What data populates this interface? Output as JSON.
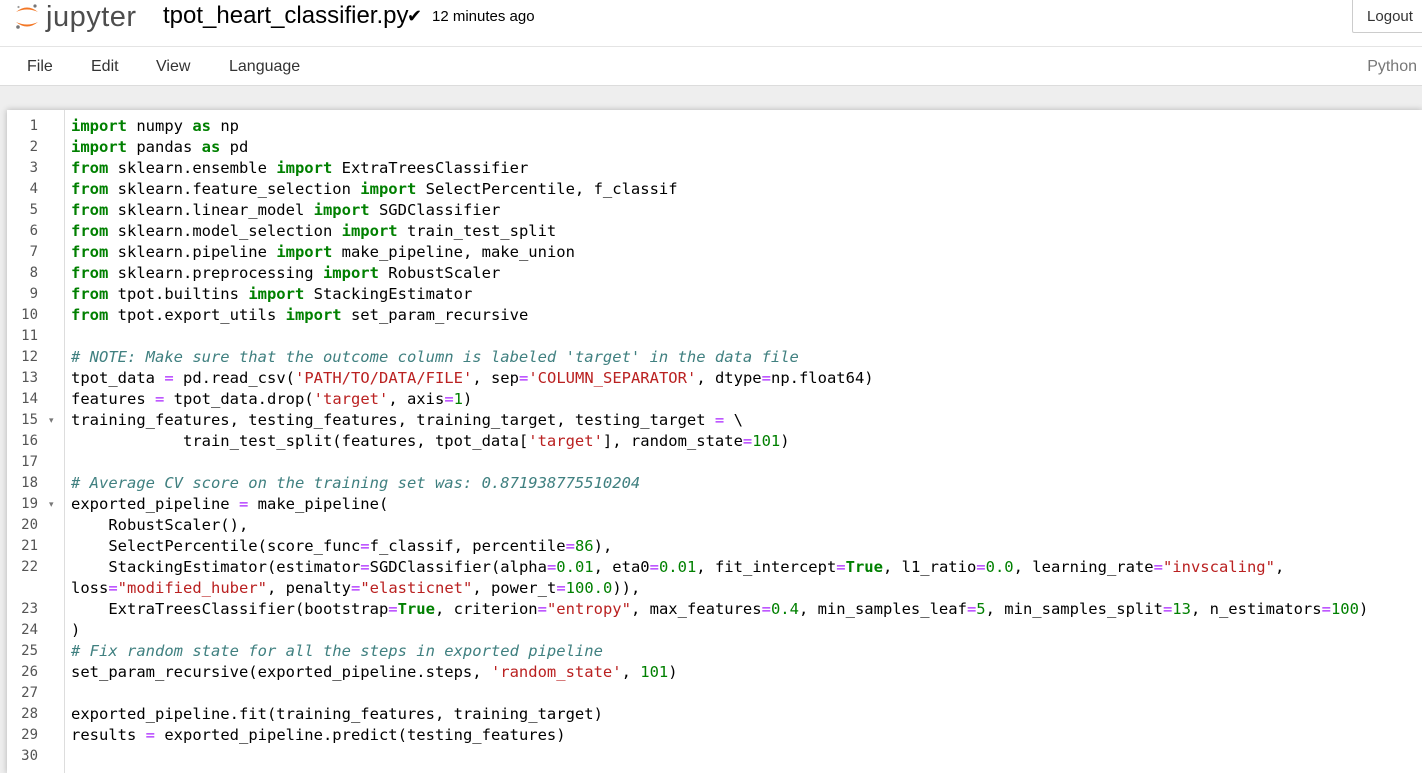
{
  "header": {
    "logo_text": "jupyter",
    "file_name": "tpot_heart_classifier.py",
    "save_status": "12 minutes ago",
    "logout_label": "Logout"
  },
  "menu": {
    "items": [
      "File",
      "Edit",
      "View",
      "Language"
    ],
    "language_indicator": "Python"
  },
  "editor": {
    "fold_markers": [
      15,
      19
    ],
    "lines": [
      [
        [
          "kw",
          "import"
        ],
        [
          "t",
          " numpy "
        ],
        [
          "kw",
          "as"
        ],
        [
          "t",
          " np"
        ]
      ],
      [
        [
          "kw",
          "import"
        ],
        [
          "t",
          " pandas "
        ],
        [
          "kw",
          "as"
        ],
        [
          "t",
          " pd"
        ]
      ],
      [
        [
          "kw",
          "from"
        ],
        [
          "t",
          " sklearn.ensemble "
        ],
        [
          "kw",
          "import"
        ],
        [
          "t",
          " ExtraTreesClassifier"
        ]
      ],
      [
        [
          "kw",
          "from"
        ],
        [
          "t",
          " sklearn.feature_selection "
        ],
        [
          "kw",
          "import"
        ],
        [
          "t",
          " SelectPercentile, f_classif"
        ]
      ],
      [
        [
          "kw",
          "from"
        ],
        [
          "t",
          " sklearn.linear_model "
        ],
        [
          "kw",
          "import"
        ],
        [
          "t",
          " SGDClassifier"
        ]
      ],
      [
        [
          "kw",
          "from"
        ],
        [
          "t",
          " sklearn.model_selection "
        ],
        [
          "kw",
          "import"
        ],
        [
          "t",
          " train_test_split"
        ]
      ],
      [
        [
          "kw",
          "from"
        ],
        [
          "t",
          " sklearn.pipeline "
        ],
        [
          "kw",
          "import"
        ],
        [
          "t",
          " make_pipeline, make_union"
        ]
      ],
      [
        [
          "kw",
          "from"
        ],
        [
          "t",
          " sklearn.preprocessing "
        ],
        [
          "kw",
          "import"
        ],
        [
          "t",
          " RobustScaler"
        ]
      ],
      [
        [
          "kw",
          "from"
        ],
        [
          "t",
          " tpot.builtins "
        ],
        [
          "kw",
          "import"
        ],
        [
          "t",
          " StackingEstimator"
        ]
      ],
      [
        [
          "kw",
          "from"
        ],
        [
          "t",
          " tpot.export_utils "
        ],
        [
          "kw",
          "import"
        ],
        [
          "t",
          " set_param_recursive"
        ]
      ],
      [],
      [
        [
          "cm",
          "# NOTE: Make sure that the outcome column is labeled 'target' in the data file"
        ]
      ],
      [
        [
          "t",
          "tpot_data "
        ],
        [
          "op",
          "="
        ],
        [
          "t",
          " pd.read_csv("
        ],
        [
          "st",
          "'PATH/TO/DATA/FILE'"
        ],
        [
          "t",
          ", sep"
        ],
        [
          "op",
          "="
        ],
        [
          "st",
          "'COLUMN_SEPARATOR'"
        ],
        [
          "t",
          ", dtype"
        ],
        [
          "op",
          "="
        ],
        [
          "t",
          "np.float64)"
        ]
      ],
      [
        [
          "t",
          "features "
        ],
        [
          "op",
          "="
        ],
        [
          "t",
          " tpot_data.drop("
        ],
        [
          "st",
          "'target'"
        ],
        [
          "t",
          ", axis"
        ],
        [
          "op",
          "="
        ],
        [
          "nm",
          "1"
        ],
        [
          "t",
          ")"
        ]
      ],
      [
        [
          "t",
          "training_features, testing_features, training_target, testing_target "
        ],
        [
          "op",
          "="
        ],
        [
          "t",
          " \\"
        ]
      ],
      [
        [
          "t",
          "            train_test_split(features, tpot_data["
        ],
        [
          "st",
          "'target'"
        ],
        [
          "t",
          "], random_state"
        ],
        [
          "op",
          "="
        ],
        [
          "nm",
          "101"
        ],
        [
          "t",
          ")"
        ]
      ],
      [],
      [
        [
          "cm",
          "# Average CV score on the training set was: 0.871938775510204"
        ]
      ],
      [
        [
          "t",
          "exported_pipeline "
        ],
        [
          "op",
          "="
        ],
        [
          "t",
          " make_pipeline("
        ]
      ],
      [
        [
          "t",
          "    RobustScaler(),"
        ]
      ],
      [
        [
          "t",
          "    SelectPercentile(score_func"
        ],
        [
          "op",
          "="
        ],
        [
          "t",
          "f_classif, percentile"
        ],
        [
          "op",
          "="
        ],
        [
          "nm",
          "86"
        ],
        [
          "t",
          "),"
        ]
      ],
      [
        [
          "t",
          "    StackingEstimator(estimator"
        ],
        [
          "op",
          "="
        ],
        [
          "t",
          "SGDClassifier(alpha"
        ],
        [
          "op",
          "="
        ],
        [
          "nm",
          "0.01"
        ],
        [
          "t",
          ", eta0"
        ],
        [
          "op",
          "="
        ],
        [
          "nm",
          "0.01"
        ],
        [
          "t",
          ", fit_intercept"
        ],
        [
          "op",
          "="
        ],
        [
          "kw",
          "True"
        ],
        [
          "t",
          ", l1_ratio"
        ],
        [
          "op",
          "="
        ],
        [
          "nm",
          "0.0"
        ],
        [
          "t",
          ", learning_rate"
        ],
        [
          "op",
          "="
        ],
        [
          "st",
          "\"invscaling\""
        ],
        [
          "t",
          ","
        ]
      ],
      [
        [
          "t",
          "loss"
        ],
        [
          "op",
          "="
        ],
        [
          "st",
          "\"modified_huber\""
        ],
        [
          "t",
          ", penalty"
        ],
        [
          "op",
          "="
        ],
        [
          "st",
          "\"elasticnet\""
        ],
        [
          "t",
          ", power_t"
        ],
        [
          "op",
          "="
        ],
        [
          "nm",
          "100.0"
        ],
        [
          "t",
          ")),"
        ]
      ],
      [
        [
          "t",
          "    ExtraTreesClassifier(bootstrap"
        ],
        [
          "op",
          "="
        ],
        [
          "kw",
          "True"
        ],
        [
          "t",
          ", criterion"
        ],
        [
          "op",
          "="
        ],
        [
          "st",
          "\"entropy\""
        ],
        [
          "t",
          ", max_features"
        ],
        [
          "op",
          "="
        ],
        [
          "nm",
          "0.4"
        ],
        [
          "t",
          ", min_samples_leaf"
        ],
        [
          "op",
          "="
        ],
        [
          "nm",
          "5"
        ],
        [
          "t",
          ", min_samples_split"
        ],
        [
          "op",
          "="
        ],
        [
          "nm",
          "13"
        ],
        [
          "t",
          ", n_estimators"
        ],
        [
          "op",
          "="
        ],
        [
          "nm",
          "100"
        ],
        [
          "t",
          ")"
        ]
      ],
      [
        [
          "t",
          ")"
        ]
      ],
      [
        [
          "cm",
          "# Fix random state for all the steps in exported pipeline"
        ]
      ],
      [
        [
          "t",
          "set_param_recursive(exported_pipeline.steps, "
        ],
        [
          "st",
          "'random_state'"
        ],
        [
          "t",
          ", "
        ],
        [
          "nm",
          "101"
        ],
        [
          "t",
          ")"
        ]
      ],
      [],
      [
        [
          "t",
          "exported_pipeline.fit(training_features, training_target)"
        ]
      ],
      [
        [
          "t",
          "results "
        ],
        [
          "op",
          "="
        ],
        [
          "t",
          " exported_pipeline.predict(testing_features)"
        ]
      ],
      []
    ],
    "line_numbers": [
      "1",
      "2",
      "3",
      "4",
      "5",
      "6",
      "7",
      "8",
      "9",
      "10",
      "11",
      "12",
      "13",
      "14",
      "15",
      "16",
      "17",
      "18",
      "19",
      "20",
      "21",
      "22",
      "",
      "23",
      "24",
      "25",
      "26",
      "27",
      "28",
      "29",
      "30"
    ]
  }
}
